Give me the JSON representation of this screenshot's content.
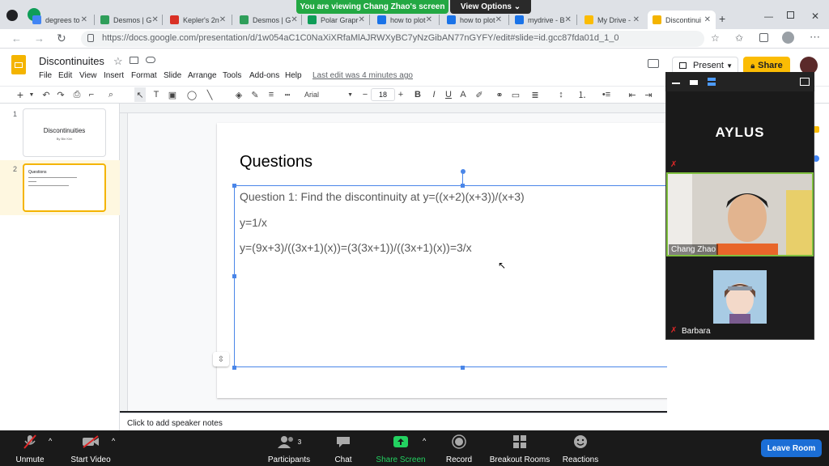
{
  "zoom_banner": {
    "viewing": "You are viewing Chang Zhao's screen",
    "view_options": "View Options"
  },
  "browser": {
    "tabs": [
      {
        "label": "degrees to",
        "color": "#4285f4"
      },
      {
        "label": "Desmos | G",
        "color": "#2f9e5a"
      },
      {
        "label": "Kepler's 2n",
        "color": "#d93025"
      },
      {
        "label": "Desmos | G",
        "color": "#2f9e5a"
      },
      {
        "label": "Polar Grapr",
        "color": "#0f9d58"
      },
      {
        "label": "how to plot",
        "color": "#1a73e8"
      },
      {
        "label": "how to plot",
        "color": "#1a73e8"
      },
      {
        "label": "mydrive - B",
        "color": "#1a73e8"
      },
      {
        "label": "My Drive -",
        "color": "#fbbc04"
      },
      {
        "label": "Discontinui",
        "color": "#f4b400"
      }
    ],
    "url": "https://docs.google.com/presentation/d/1w054aC1C0NaXiXRfaMlAJRWXyBC7yNzGibAN77nGYFY/edit#slide=id.gcc87fda01d_1_0"
  },
  "slides": {
    "title": "Discontinuites",
    "menu": [
      "File",
      "Edit",
      "View",
      "Insert",
      "Format",
      "Slide",
      "Arrange",
      "Tools",
      "Add-ons",
      "Help"
    ],
    "last_edit": "Last edit was 4 minutes ago",
    "present_label": "Present",
    "share_label": "Share",
    "font_name": "Arial",
    "font_size": "18",
    "thumbnails": [
      {
        "num": "1",
        "title": "Discontinuities",
        "subtitle": "By Bin Kim"
      },
      {
        "num": "2",
        "title": "Questions"
      }
    ],
    "slide_heading": "Questions",
    "body_lines": [
      "Question 1: Find the discontinuity at y=((x+2)(x+3))/(x+3)",
      "y=1/x",
      "y=(9x+3)/((3x+1)(x))=(3(3x+1))/((3x+1)(x))=3/x"
    ],
    "speaker_notes_placeholder": "Click to add speaker notes"
  },
  "gallery": {
    "host_tile": "AYLUS",
    "participants": [
      {
        "name": "Chang Zhao"
      },
      {
        "name": "Barbara"
      }
    ]
  },
  "zoom_controls": {
    "unmute": "Unmute",
    "start_video": "Start Video",
    "participants": "Participants",
    "participants_count": "3",
    "chat": "Chat",
    "share_screen": "Share Screen",
    "record": "Record",
    "breakout_rooms": "Breakout Rooms",
    "reactions": "Reactions",
    "leave": "Leave Room"
  },
  "colors": {
    "zoom_green": "#23a843",
    "share_yellow": "#fbbc04",
    "leave_blue": "#1b6ed6",
    "speaker_border": "#7fbf3f"
  }
}
